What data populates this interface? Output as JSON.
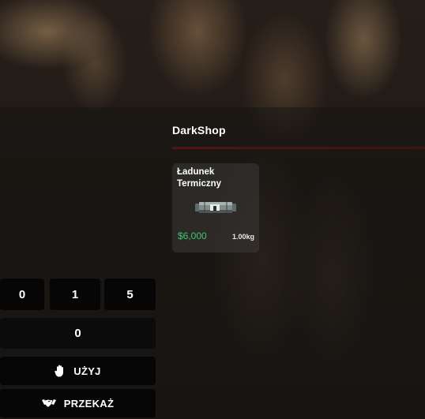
{
  "shop": {
    "title": "DarkShop",
    "accent_line_color": "#7a1414"
  },
  "items": [
    {
      "name": "Ładunek Termiczny",
      "price": "$6,000",
      "price_color": "#3ec86a",
      "weight": "1.00kg",
      "icon": "thermal-charge-icon"
    }
  ],
  "keypad": {
    "digits": [
      "0",
      "1",
      "5"
    ]
  },
  "amount": {
    "value": "0"
  },
  "actions": {
    "use": {
      "label": "UŻYJ",
      "icon": "hand-icon"
    },
    "give": {
      "label": "PRZEKAŻ",
      "icon": "handshake-icon"
    }
  }
}
